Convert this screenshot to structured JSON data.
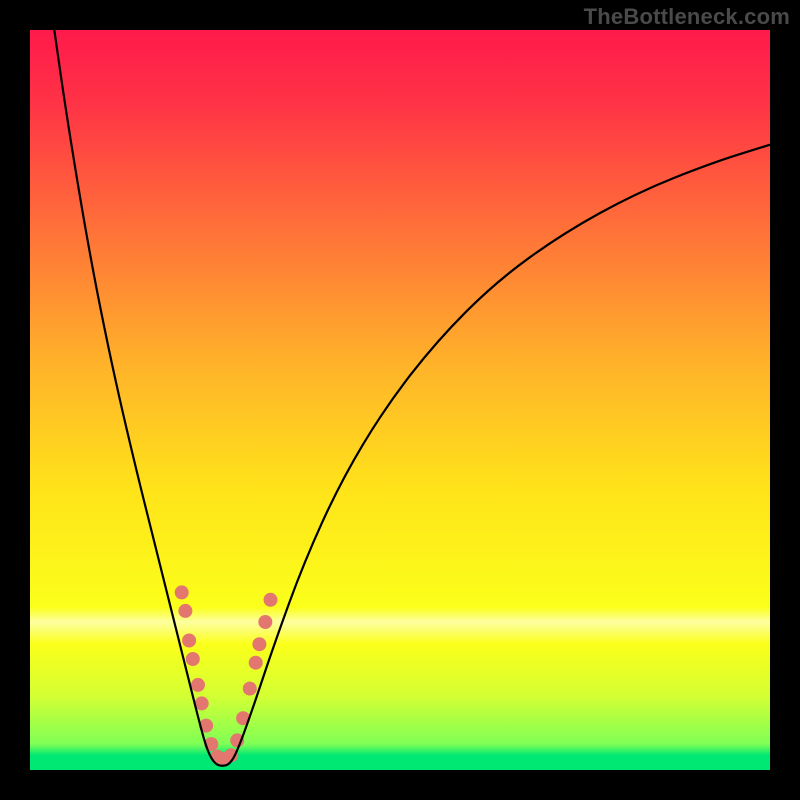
{
  "watermark": "TheBottleneck.com",
  "chart_data": {
    "type": "line",
    "title": "",
    "xlabel": "",
    "ylabel": "",
    "xlim": [
      0,
      100
    ],
    "ylim": [
      0,
      100
    ],
    "grid": false,
    "legend": false,
    "background_gradient": {
      "stops": [
        {
          "pos": 0.0,
          "color": "#ff1a4b"
        },
        {
          "pos": 0.1,
          "color": "#ff3346"
        },
        {
          "pos": 0.25,
          "color": "#ff6a3a"
        },
        {
          "pos": 0.45,
          "color": "#ffb22a"
        },
        {
          "pos": 0.62,
          "color": "#ffe31a"
        },
        {
          "pos": 0.78,
          "color": "#fbff1a"
        },
        {
          "pos": 0.8,
          "color": "#fdffa0"
        },
        {
          "pos": 0.83,
          "color": "#fbff1a"
        },
        {
          "pos": 0.9,
          "color": "#d4ff33"
        },
        {
          "pos": 0.965,
          "color": "#7fff55"
        },
        {
          "pos": 0.98,
          "color": "#00e874"
        },
        {
          "pos": 1.0,
          "color": "#00e874"
        }
      ]
    },
    "series": [
      {
        "name": "bottleneck-curve",
        "color": "#000000",
        "width": 2.2,
        "points": [
          {
            "x": 3.0,
            "y": 102.0
          },
          {
            "x": 5.0,
            "y": 88.0
          },
          {
            "x": 8.0,
            "y": 70.0
          },
          {
            "x": 11.0,
            "y": 55.0
          },
          {
            "x": 14.0,
            "y": 42.0
          },
          {
            "x": 17.0,
            "y": 30.0
          },
          {
            "x": 19.5,
            "y": 20.0
          },
          {
            "x": 21.5,
            "y": 12.0
          },
          {
            "x": 23.0,
            "y": 6.0
          },
          {
            "x": 24.0,
            "y": 2.5
          },
          {
            "x": 25.0,
            "y": 0.8
          },
          {
            "x": 26.0,
            "y": 0.5
          },
          {
            "x": 27.0,
            "y": 0.8
          },
          {
            "x": 28.0,
            "y": 2.5
          },
          {
            "x": 30.0,
            "y": 8.0
          },
          {
            "x": 33.0,
            "y": 17.0
          },
          {
            "x": 37.0,
            "y": 28.0
          },
          {
            "x": 42.0,
            "y": 39.0
          },
          {
            "x": 48.0,
            "y": 49.0
          },
          {
            "x": 55.0,
            "y": 58.0
          },
          {
            "x": 63.0,
            "y": 66.0
          },
          {
            "x": 72.0,
            "y": 72.5
          },
          {
            "x": 82.0,
            "y": 78.0
          },
          {
            "x": 92.0,
            "y": 82.0
          },
          {
            "x": 100.0,
            "y": 84.5
          }
        ]
      }
    ],
    "markers": {
      "name": "highlight-dots",
      "color": "#e3766f",
      "radius": 7,
      "points": [
        {
          "x": 20.5,
          "y": 24.0
        },
        {
          "x": 21.0,
          "y": 21.5
        },
        {
          "x": 21.5,
          "y": 17.5
        },
        {
          "x": 22.0,
          "y": 15.0
        },
        {
          "x": 22.7,
          "y": 11.5
        },
        {
          "x": 23.2,
          "y": 9.0
        },
        {
          "x": 23.8,
          "y": 6.0
        },
        {
          "x": 24.5,
          "y": 3.5
        },
        {
          "x": 25.3,
          "y": 1.8
        },
        {
          "x": 26.3,
          "y": 1.5
        },
        {
          "x": 27.2,
          "y": 2.0
        },
        {
          "x": 28.0,
          "y": 4.0
        },
        {
          "x": 28.8,
          "y": 7.0
        },
        {
          "x": 29.7,
          "y": 11.0
        },
        {
          "x": 30.5,
          "y": 14.5
        },
        {
          "x": 31.0,
          "y": 17.0
        },
        {
          "x": 31.8,
          "y": 20.0
        },
        {
          "x": 32.5,
          "y": 23.0
        }
      ]
    }
  }
}
